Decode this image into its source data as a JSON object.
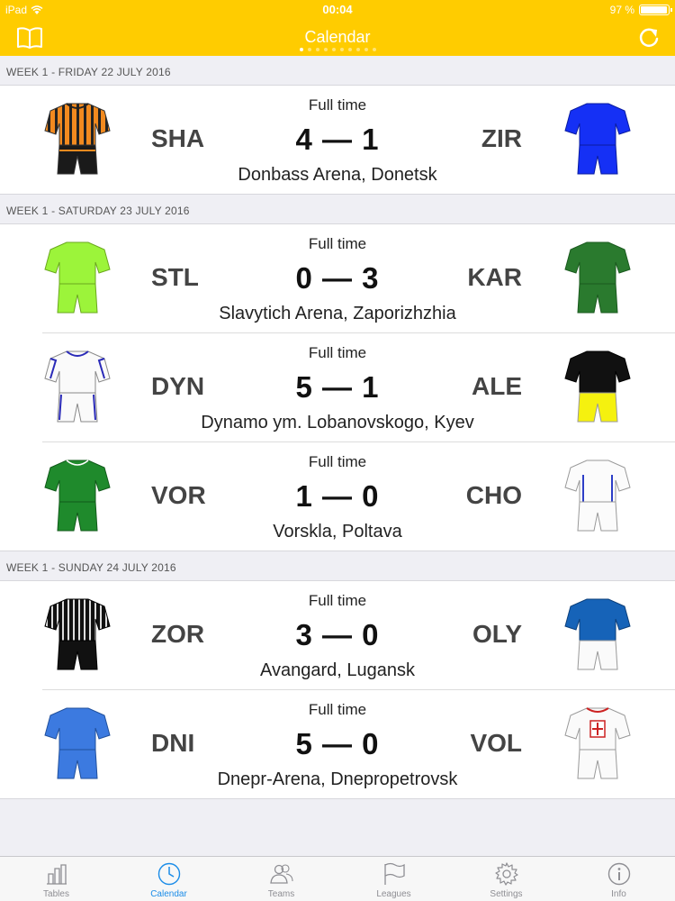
{
  "status_bar": {
    "device": "iPad",
    "time": "00:04",
    "battery": "97 %"
  },
  "nav": {
    "title": "Calendar"
  },
  "colors": {
    "accent": "#ffcc00",
    "tab_active": "#1a8ce8",
    "tab_inactive": "#8e8e93"
  },
  "sections": [
    {
      "header": "WEEK 1 - FRIDAY 22 JULY 2016",
      "matches": [
        {
          "status": "Full time",
          "home": "SHA",
          "away": "ZIR",
          "score": "4 — 1",
          "venue": "Donbass Arena, Donetsk",
          "home_kit": "shakhtar-kit",
          "away_kit": "zirka-kit"
        }
      ]
    },
    {
      "header": "WEEK 1 - SATURDAY 23 JULY 2016",
      "matches": [
        {
          "status": "Full time",
          "home": "STL",
          "away": "KAR",
          "score": "0 — 3",
          "venue": "Slavytich Arena, Zaporizhzhia",
          "home_kit": "stal-kit",
          "away_kit": "karpaty-kit"
        },
        {
          "status": "Full time",
          "home": "DYN",
          "away": "ALE",
          "score": "5 — 1",
          "venue": "Dynamo ym. Lobanovskogo, Kyev",
          "home_kit": "dynamo-kit",
          "away_kit": "oleksandria-kit"
        },
        {
          "status": "Full time",
          "home": "VOR",
          "away": "CHO",
          "score": "1 — 0",
          "venue": "Vorskla, Poltava",
          "home_kit": "vorskla-kit",
          "away_kit": "chornomorets-kit"
        }
      ]
    },
    {
      "header": "WEEK 1 - SUNDAY 24 JULY 2016",
      "matches": [
        {
          "status": "Full time",
          "home": "ZOR",
          "away": "OLY",
          "score": "3 — 0",
          "venue": "Avangard, Lugansk",
          "home_kit": "zorya-kit",
          "away_kit": "olimpik-kit"
        },
        {
          "status": "Full time",
          "home": "DNI",
          "away": "VOL",
          "score": "5 — 0",
          "venue": "Dnepr-Arena, Dnepropetrovsk",
          "home_kit": "dnipro-kit",
          "away_kit": "volyn-kit"
        }
      ]
    }
  ],
  "tabs": [
    {
      "label": "Tables",
      "icon": "bar-chart-icon"
    },
    {
      "label": "Calendar",
      "icon": "clock-icon",
      "active": true
    },
    {
      "label": "Teams",
      "icon": "people-icon"
    },
    {
      "label": "Leagues",
      "icon": "flag-icon"
    },
    {
      "label": "Settings",
      "icon": "gear-icon"
    },
    {
      "label": "Info",
      "icon": "info-icon"
    }
  ]
}
